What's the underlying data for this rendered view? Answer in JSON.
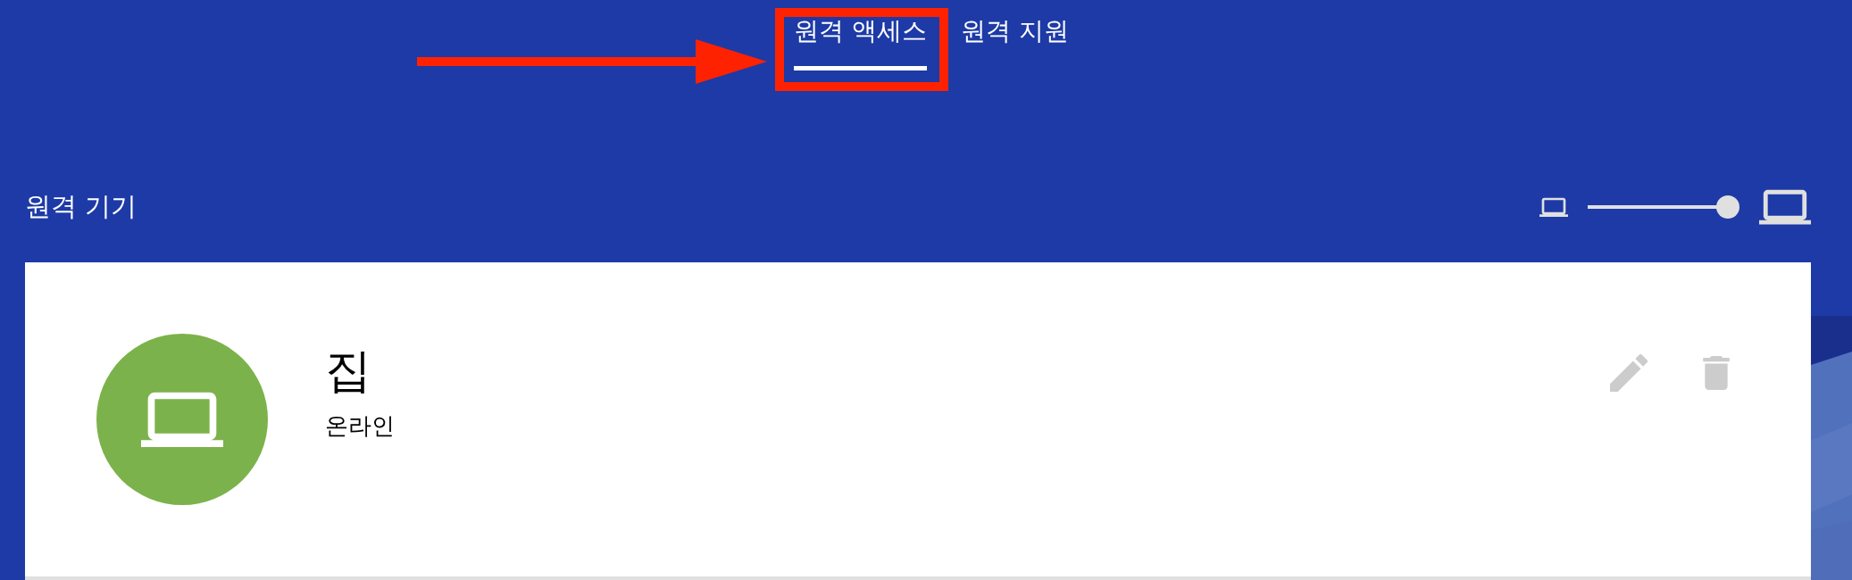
{
  "tabs": [
    {
      "label": "원격 액세스",
      "selected": true
    },
    {
      "label": "원격 지원",
      "selected": false
    }
  ],
  "section": {
    "title": "원격 기기",
    "size_slider": {
      "level": 1
    }
  },
  "devices": [
    {
      "name": "집",
      "status": "온라인"
    }
  ]
}
